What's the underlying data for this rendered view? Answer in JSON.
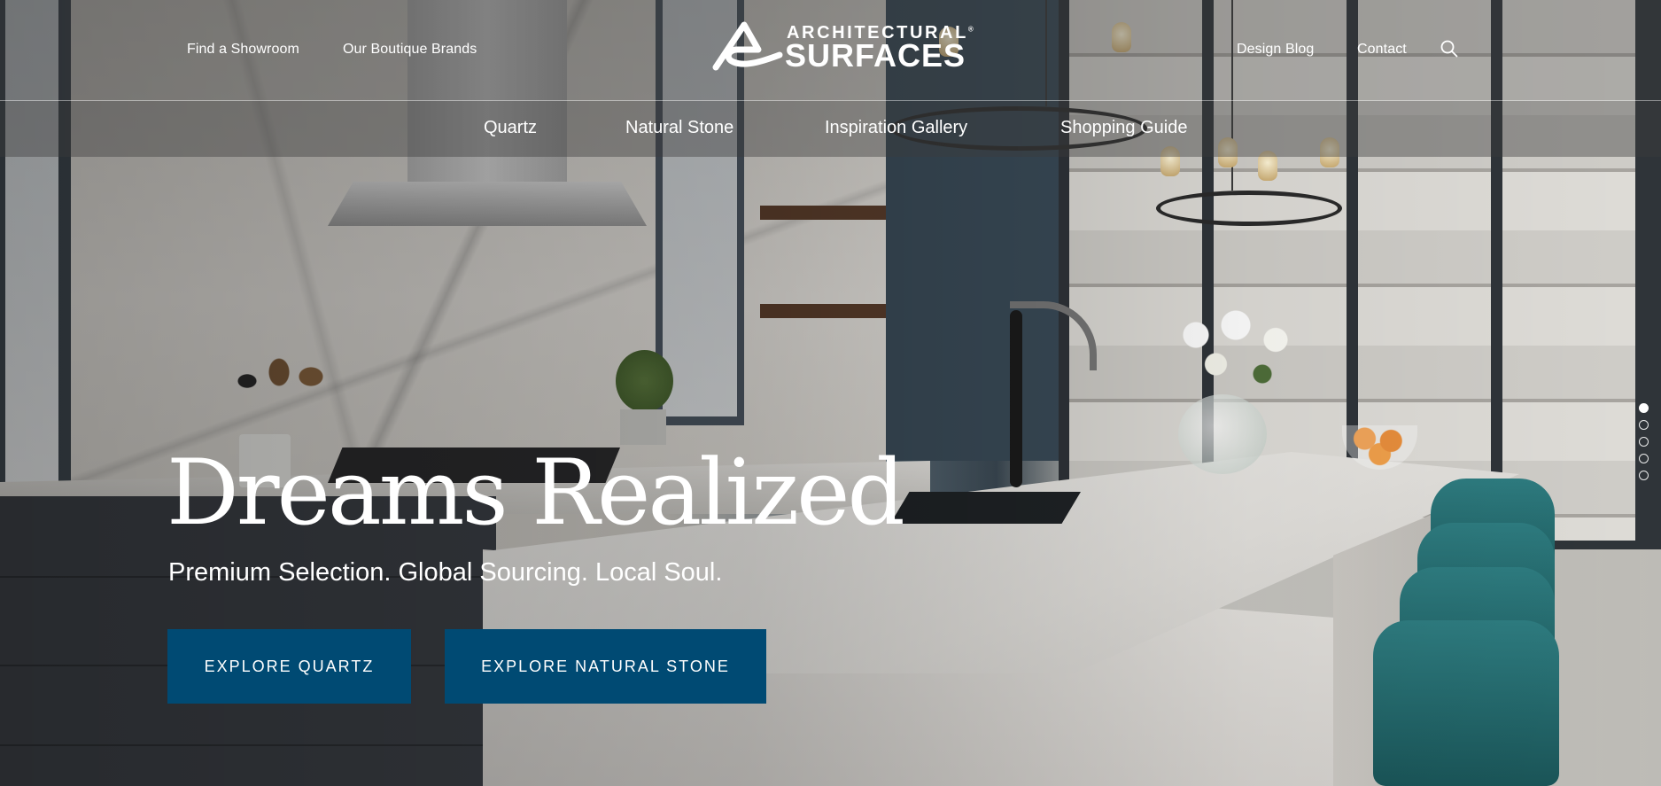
{
  "header": {
    "top_links": [
      {
        "label": "Find a Showroom"
      },
      {
        "label": "Our Boutique Brands"
      },
      {
        "label": "Design Blog"
      },
      {
        "label": "Contact"
      }
    ],
    "logo": {
      "line1": "ARCHITECTURAL",
      "registered": "®",
      "line2": "SURFACES"
    },
    "search_icon": "search-icon",
    "main_nav": [
      {
        "label": "Quartz"
      },
      {
        "label": "Natural Stone"
      },
      {
        "label": "Inspiration Gallery"
      },
      {
        "label": "Shopping Guide"
      }
    ]
  },
  "hero": {
    "title": "Dreams Realized",
    "subtitle": "Premium Selection. Global Sourcing. Local Soul.",
    "buttons": [
      {
        "label": "EXPLORE QUARTZ"
      },
      {
        "label": "EXPLORE NATURAL STONE"
      }
    ],
    "image_description": "Modern kitchen with white marble quartz island, teal bar stools, and large windows",
    "slide_count": 5,
    "active_slide": 1
  },
  "colors": {
    "button_bg": "#004a73",
    "text": "#ffffff",
    "header_overlay": "rgba(60,60,60,0.35)"
  }
}
